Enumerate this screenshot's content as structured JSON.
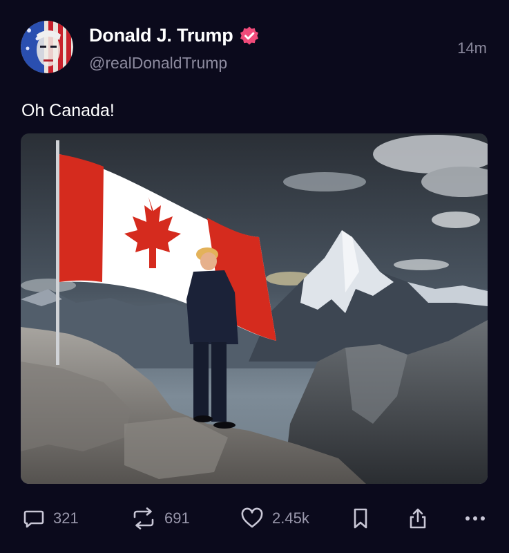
{
  "post": {
    "author": {
      "display_name": "Donald J. Trump",
      "handle": "@realDonaldTrump",
      "verified": true
    },
    "timestamp": "14m",
    "text": "Oh Canada!",
    "media": {
      "kind": "image",
      "depicts": [
        "canada-flag",
        "man-in-suit",
        "mountain-peak",
        "cliff-rocks",
        "cloudy-sky"
      ]
    }
  },
  "actions": {
    "replies": "321",
    "reposts": "691",
    "likes": "2.45k"
  },
  "icons": {
    "verified": "verified-badge-icon",
    "reply": "comment-icon",
    "repost": "repost-icon",
    "like": "heart-icon",
    "bookmark": "bookmark-icon",
    "share": "share-icon",
    "more": "more-dots-icon"
  },
  "colors": {
    "background": "#0b0a1c",
    "verified_badge": "#f04b7a",
    "secondary_text": "#8c8a9e",
    "icon": "#c9c7d6"
  }
}
